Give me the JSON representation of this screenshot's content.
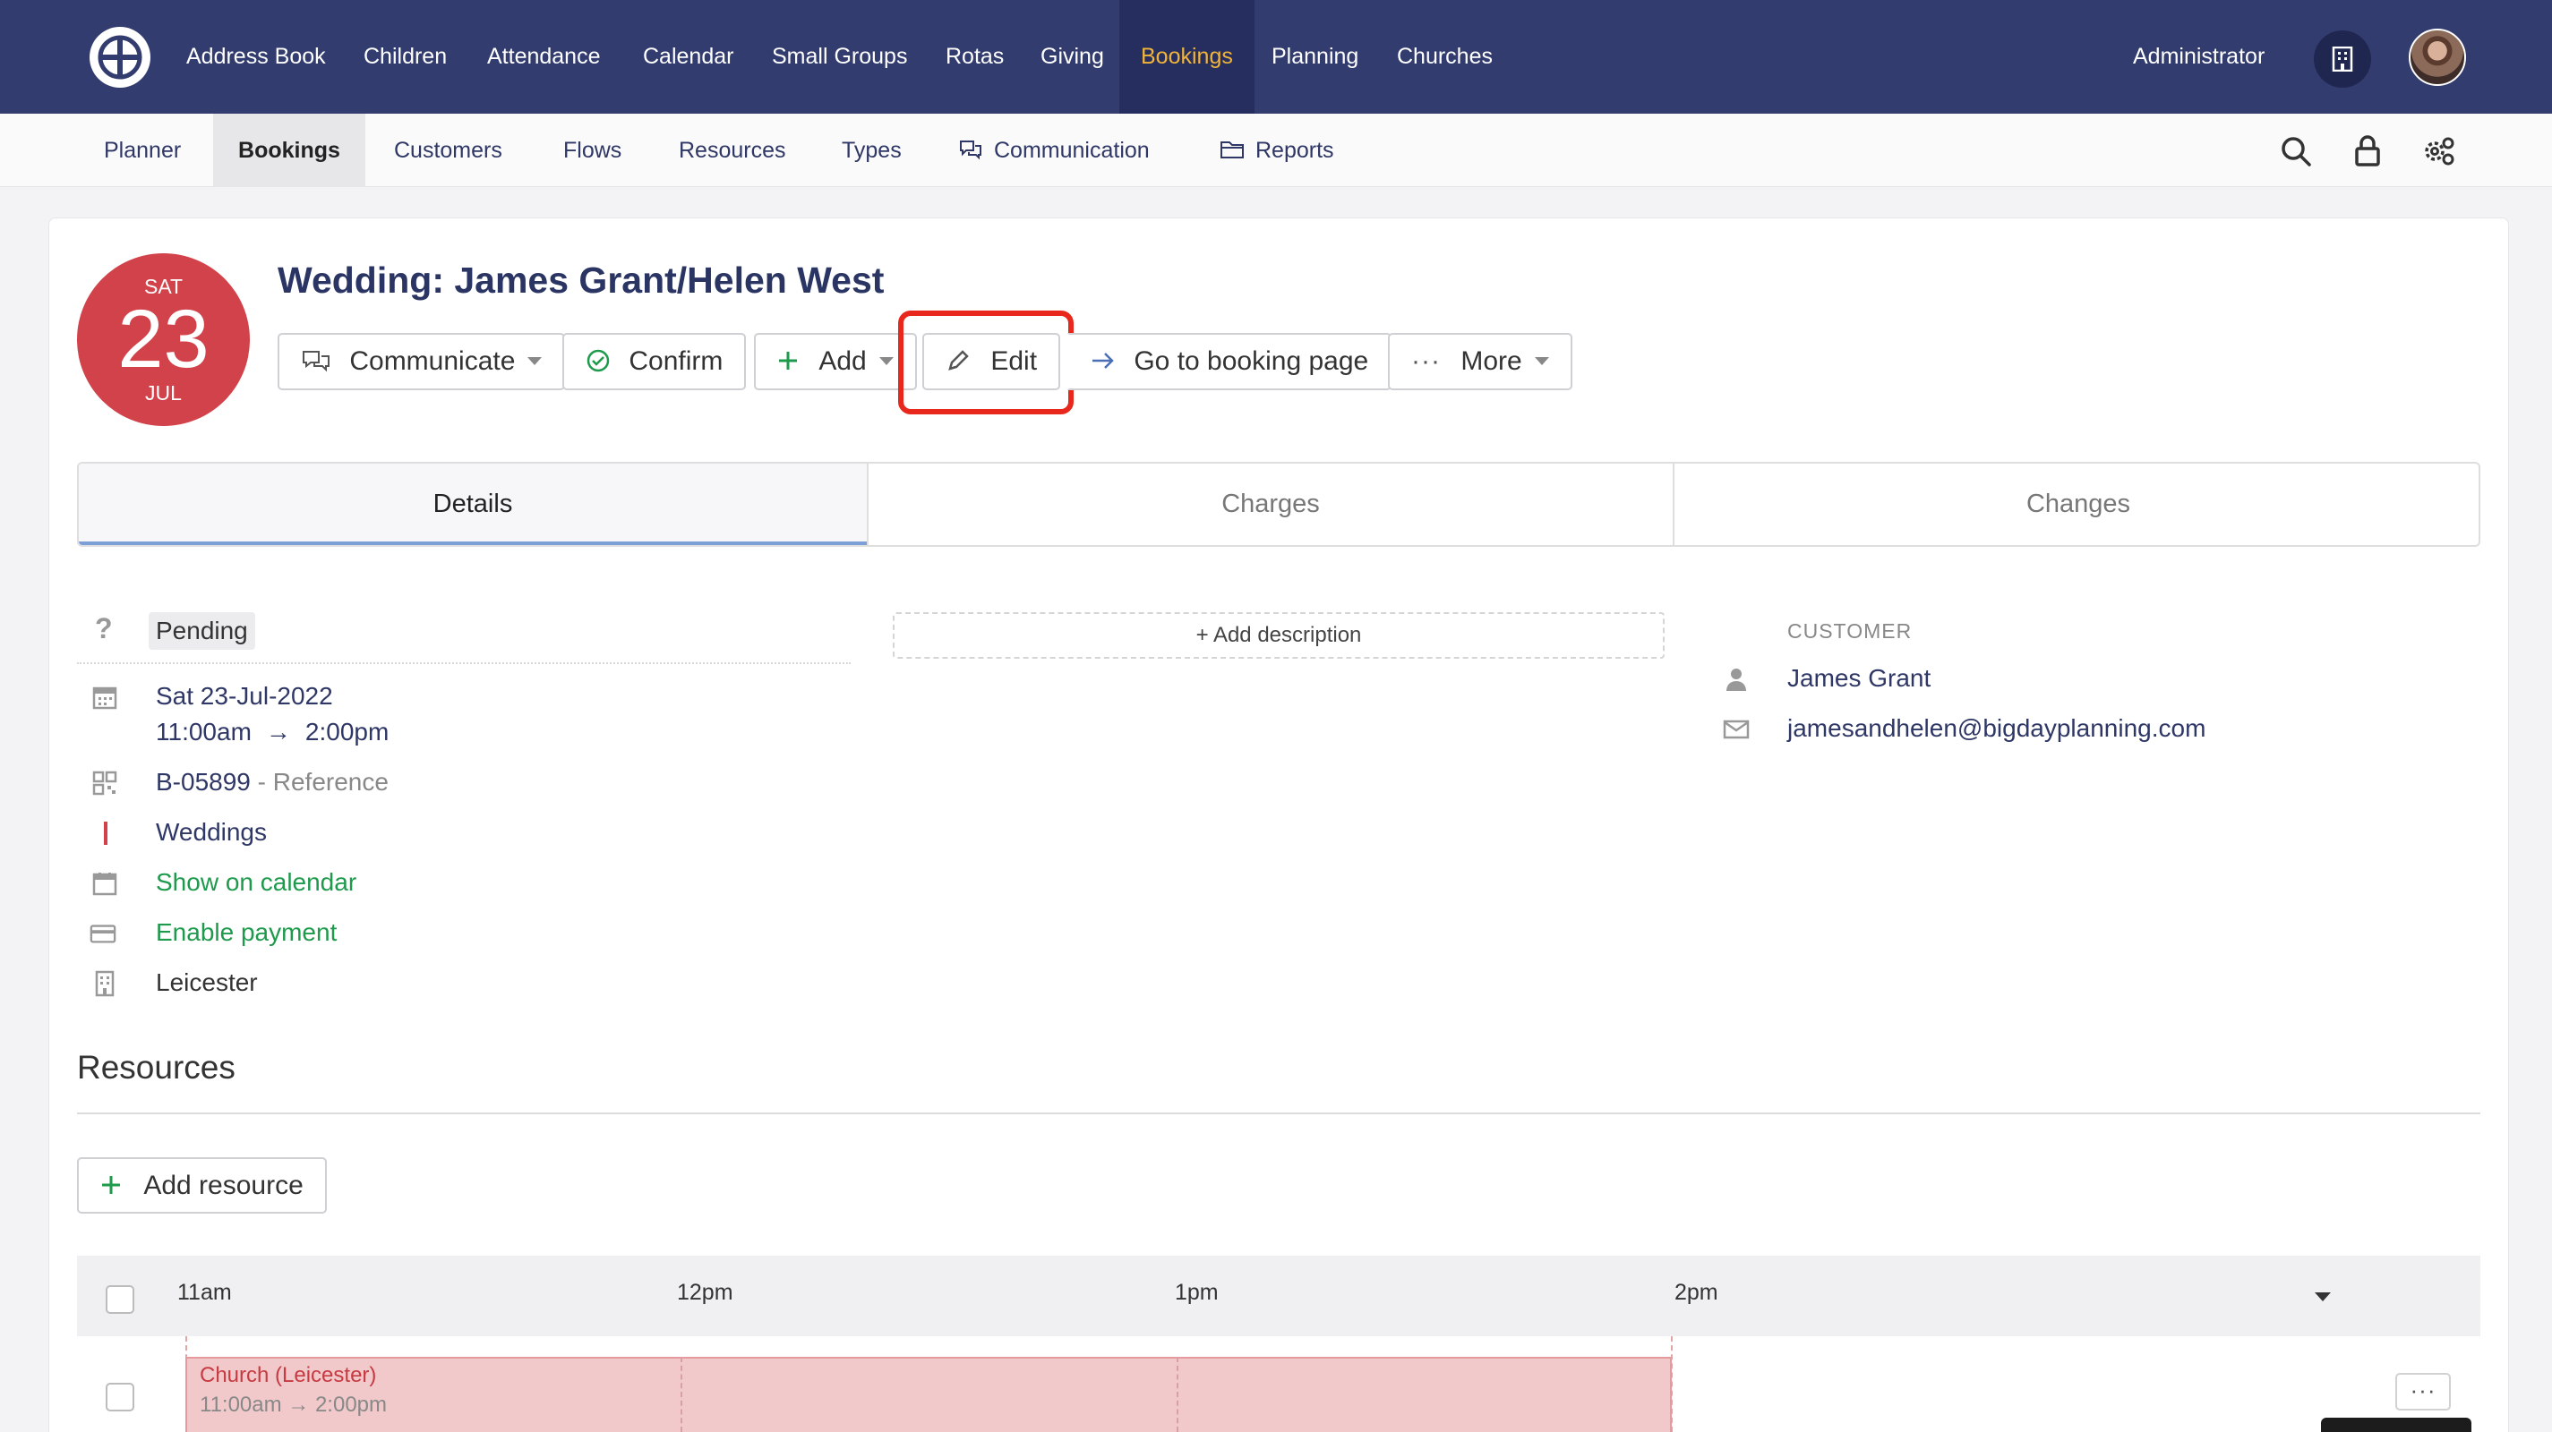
{
  "topnav": {
    "items": [
      "Address Book",
      "Children",
      "Attendance",
      "Calendar",
      "Small Groups",
      "Rotas",
      "Giving",
      "Bookings",
      "Planning",
      "Churches"
    ],
    "active": "Bookings",
    "user_label": "Administrator",
    "icons": [
      "logo-icon",
      "building-icon",
      "avatar"
    ],
    "active_color": "#f0b43c",
    "bar_color": "#323c6e"
  },
  "subnav": {
    "items": [
      "Planner",
      "Bookings",
      "Customers",
      "Flows",
      "Resources",
      "Types",
      "Communication",
      "Reports"
    ],
    "active": "Bookings",
    "tool_icons": [
      "search-icon",
      "lock-icon",
      "settings-icon"
    ]
  },
  "booking": {
    "date": {
      "dow": "SAT",
      "day": "23",
      "month": "JUL"
    },
    "title": "Wedding: James Grant/Helen West",
    "actions": {
      "communicate": "Communicate",
      "confirm": "Confirm",
      "add": "Add",
      "edit": "Edit",
      "go_to_page": "Go to booking page",
      "more": "More"
    }
  },
  "tabs": [
    "Details",
    "Charges",
    "Changes"
  ],
  "details": {
    "status": "Pending",
    "date_line": "Sat 23-Jul-2022",
    "time_start": "11:00am",
    "time_arrow": "→",
    "time_end": "2:00pm",
    "reference_code": "B-05899",
    "reference_label": " - Reference",
    "type": "Weddings",
    "show_on_calendar": "Show on calendar",
    "enable_payment": "Enable payment",
    "location": "Leicester",
    "add_description": "+ Add description"
  },
  "customer": {
    "heading": "CUSTOMER",
    "name": "James Grant",
    "email": "jamesandhelen@bigdayplanning.com"
  },
  "resources": {
    "heading": "Resources",
    "add_label": "Add resource",
    "hours": [
      "11am",
      "12pm",
      "1pm",
      "2pm"
    ],
    "rows": [
      {
        "name": "Church (Leicester)",
        "time": "11:00am → 2:00pm"
      }
    ],
    "more_label": "···"
  },
  "colors": {
    "date_badge": "#d2424a",
    "edit_highlight": "#e8281c",
    "green_link": "#1e9a4c",
    "slot_fill": "#f2c9cb"
  }
}
